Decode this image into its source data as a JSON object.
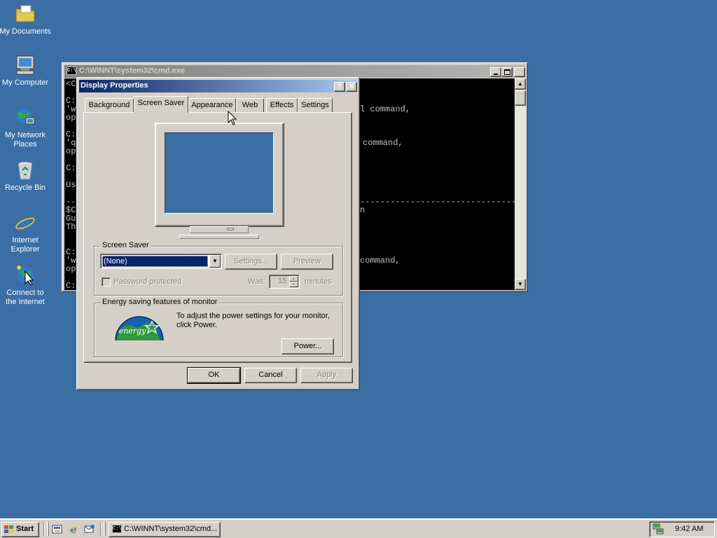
{
  "desktop": {
    "icons": [
      {
        "label": "My Documents"
      },
      {
        "label": "My Computer"
      },
      {
        "label": "My Network Places"
      },
      {
        "label": "Recycle Bin"
      },
      {
        "label": "Internet Explorer"
      },
      {
        "label": "Connect to the Internet"
      }
    ]
  },
  "cmd": {
    "title": "C:\\WINNT\\system32\\cmd.exe",
    "left_lines": [
      "<C",
      "",
      "C:",
      "'w",
      "op",
      "",
      "C:",
      "'q",
      "op",
      "",
      "C:",
      "",
      "Us",
      "",
      "--",
      "$C",
      "Gu",
      "Th",
      "",
      "",
      "C:",
      "'w",
      "op",
      "",
      "C:"
    ],
    "right_text": {
      "line1": "l command,",
      "line2": "command,",
      "dashes": "----------------------------------------------------------------------",
      "line3": "n",
      "line4": "command,"
    }
  },
  "dialog": {
    "title": "Display Properties",
    "help_btn": "?",
    "close_btn": "✕",
    "tabs": [
      "Background",
      "Screen Saver",
      "Appearance",
      "Web",
      "Effects",
      "Settings"
    ],
    "active_tab": "Screen Saver",
    "screensaver": {
      "group_label": "Screen Saver",
      "selected": "(None)",
      "settings_btn": "Settings...",
      "preview_btn": "Preview",
      "password_label": "Password protected",
      "wait_label": "Wait:",
      "wait_value": "15",
      "minutes_label": "minutes"
    },
    "energy": {
      "group_label": "Energy saving features of monitor",
      "description": "To adjust the power settings for your monitor, click Power.",
      "logo_text": "energy",
      "power_btn": "Power..."
    },
    "ok": "OK",
    "cancel": "Cancel",
    "apply": "Apply"
  },
  "taskbar": {
    "start": "Start",
    "task_label": "C:\\WINNT\\system32\\cmd...",
    "clock": "9:42 AM"
  },
  "colors": {
    "desktop": "#3a6ea5",
    "face": "#d4d0c8",
    "active_title": "#0a246a",
    "inactive_title": "#808080",
    "selection": "#0a246a"
  }
}
